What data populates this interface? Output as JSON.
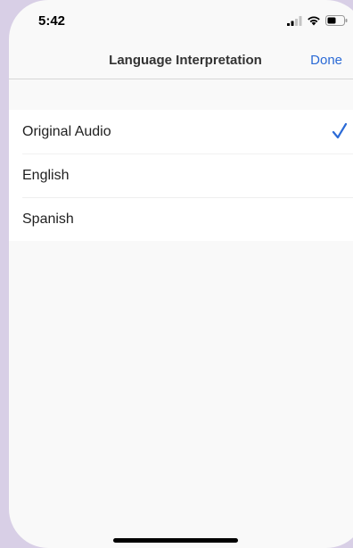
{
  "status_bar": {
    "time": "5:42",
    "icons": [
      "cellular-signal-icon",
      "wifi-icon",
      "battery-icon"
    ]
  },
  "nav": {
    "title": "Language Interpretation",
    "done_label": "Done"
  },
  "list": {
    "items": [
      {
        "label": "Original Audio",
        "selected": true
      },
      {
        "label": "English",
        "selected": false
      },
      {
        "label": "Spanish",
        "selected": false
      }
    ]
  },
  "colors": {
    "accent": "#2b6ad6",
    "background": "#f9f9f9",
    "frame": "#d8cfe6"
  }
}
